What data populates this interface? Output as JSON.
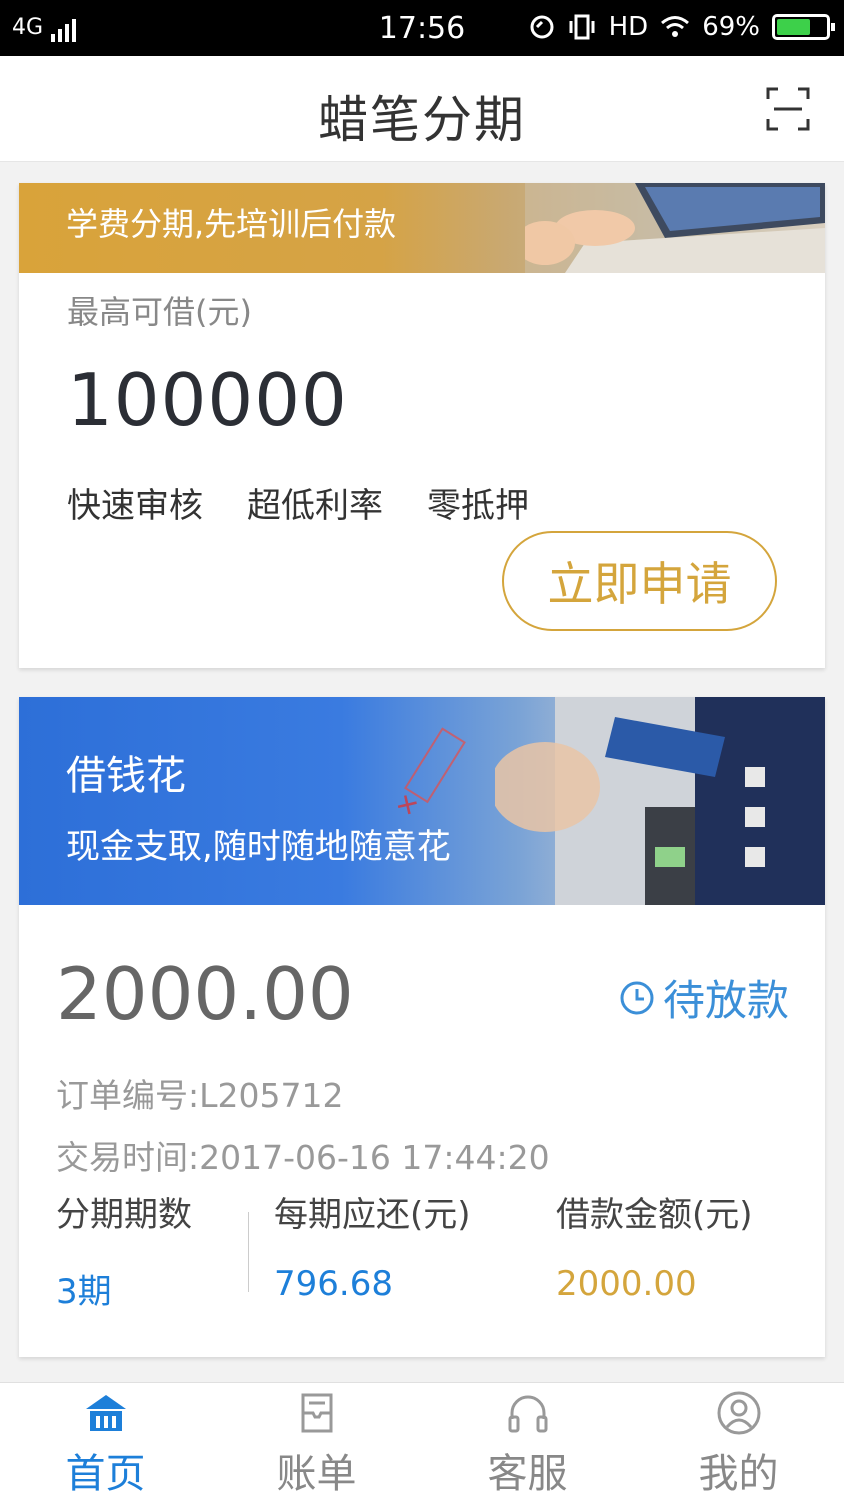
{
  "status_bar": {
    "network": "4G",
    "time": "17:56",
    "hd": "HD",
    "battery": "69%"
  },
  "header": {
    "title": "蜡笔分期"
  },
  "tuition_card": {
    "banner_text": "学费分期,先培训后付款",
    "max_label": "最高可借(元)",
    "max_amount": "100000",
    "features": [
      "快速审核",
      "超低利率",
      "零抵押"
    ],
    "apply_label": "立即申请"
  },
  "cash_card": {
    "title": "借钱花",
    "subtitle": "现金支取,随时随地随意花",
    "amount": "2000.00",
    "status": "待放款",
    "order_no": "订单编号:L205712",
    "trade_time": "交易时间:2017-06-16 17:44:20",
    "stats": [
      {
        "label": "分期期数",
        "value": "3期"
      },
      {
        "label": "每期应还(元)",
        "value": "796.68"
      },
      {
        "label": "借款金额(元)",
        "value": "2000.00"
      }
    ]
  },
  "tabs": [
    {
      "label": "首页",
      "icon": "home-icon"
    },
    {
      "label": "账单",
      "icon": "bill-icon"
    },
    {
      "label": "客服",
      "icon": "headset-icon"
    },
    {
      "label": "我的",
      "icon": "user-icon"
    }
  ],
  "colors": {
    "accent_blue": "#1d7fd9",
    "gold": "#d4a53c",
    "status_blue": "#3b8fd8"
  }
}
